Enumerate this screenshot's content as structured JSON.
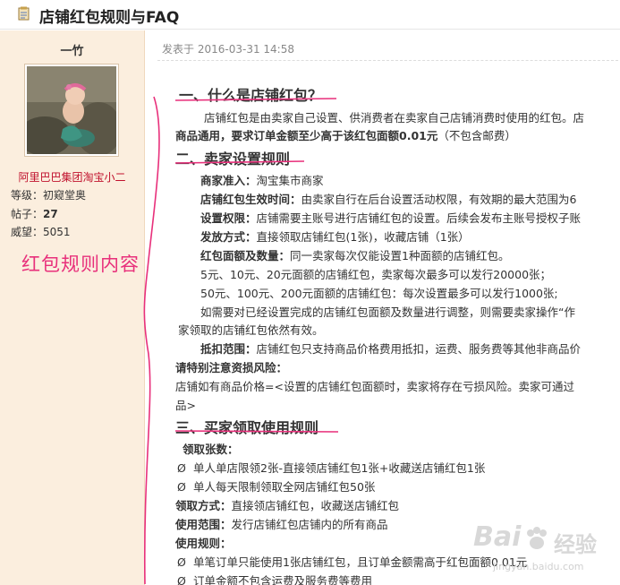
{
  "header": {
    "title": "店铺红包规则与FAQ",
    "icon": "document-icon"
  },
  "sidebar": {
    "username": "一竹",
    "group": "阿里巴巴集团淘宝小二",
    "level_label": "等级：",
    "level_value": "初窥堂奥",
    "posts_label": "帖子：",
    "posts_value": "27",
    "prestige_label": "威望：",
    "prestige_value": "5051"
  },
  "annotation": "红包规则内容",
  "post": {
    "posted_label": "发表于",
    "posted_time": "2016-03-31 14:58",
    "s1_title": "一、什么是店铺红包？",
    "s1_p1": "店铺红包是由卖家自己设置、供消费者在卖家自己店铺消费时使用的红包。店",
    "s1_p2a": "商品通用，要求订单金额至少高于该红包面额0.01元",
    "s1_p2b": "（不包含邮费）",
    "s2_title": "二、卖家设置规则",
    "s2_l1_label": "商家准入：",
    "s2_l1_text": "淘宝集市商家",
    "s2_l2_label": "店铺红包生效时间：",
    "s2_l2_text": "由卖家自行在后台设置活动权限，有效期的最大范围为6",
    "s2_l3_label": "设置权限：",
    "s2_l3_text": "店铺需要主账号进行店铺红包的设置。后续会发布主账号授权子账",
    "s2_l4_label": "发放方式：",
    "s2_l4_text": "直接领取店铺红包(1张)，收藏店铺（1张）",
    "s2_l5_label": "红包面额及数量：",
    "s2_l5_text": "同一卖家每次仅能设置1种面额的店铺红包。",
    "s2_l6": "5元、10元、20元面额的店铺红包，卖家每次最多可以发行20000张；",
    "s2_l7": "50元、100元、200元面额的店铺红包：每次设置最多可以发行1000张;",
    "s2_l8": "如需要对已经设置完成的店铺红包面额及数量进行调整，则需要卖家操作“作",
    "s2_l9": "家领取的店铺红包依然有效。",
    "s2_l10_label": "抵扣范围：",
    "s2_l10_text": "店铺红包只支持商品价格费用抵扣，运费、服务费等其他非商品价",
    "s2_l11": "请特别注意资损风险：",
    "s2_l12": "店铺如有商品价格=<设置的店铺红包面额时，卖家将存在亏损风险。卖家可通过",
    "s2_l13": "品>",
    "s3_title": "三、买家领取使用规则",
    "s3_l1": "领取张数：",
    "bullet": "Ø",
    "s3_l2": "单人单店限领2张-直接领店铺红包1张+收藏送店铺红包1张",
    "s3_l3": "单人每天限制领取全网店铺红包50张",
    "s3_l4_label": "领取方式：",
    "s3_l4_text": "直接领店铺红包，收藏送店铺红包",
    "s3_l5_label": "使用范围：",
    "s3_l5_text": "发行店铺红包店铺内的所有商品",
    "s3_l6": "使用规则：",
    "s3_l7": "单笔订单只能使用1张店铺红包，且订单金额需高于红包面额0.01元",
    "s3_l8": "订单金额不包含运费及服务费等费用"
  },
  "watermark": {
    "brand": "Bai",
    "paw": "paw-icon",
    "brand_suffix": "经验",
    "site": "jingyan.baidu.com"
  },
  "colors": {
    "sidebar_bg": "#fbeede",
    "annotation": "#e8307b",
    "group_link": "#c0102c",
    "watermark": "#d5d5d5"
  }
}
